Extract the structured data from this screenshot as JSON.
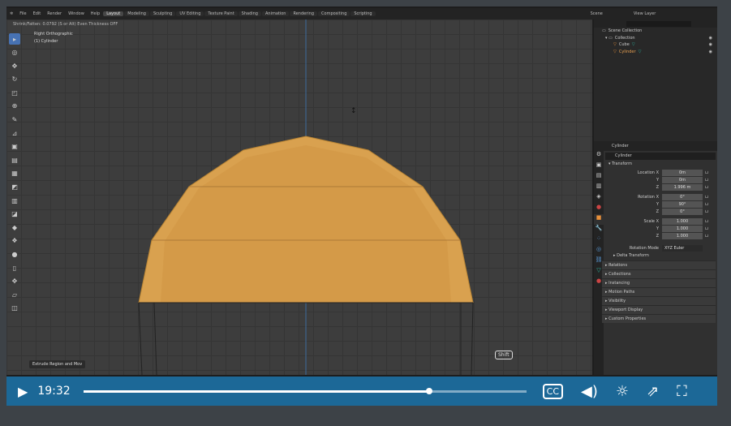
{
  "menu": [
    "File",
    "Edit",
    "Render",
    "Window",
    "Help"
  ],
  "workspaces": [
    "Layout",
    "Modeling",
    "Sculpting",
    "UV Editing",
    "Texture Paint",
    "Shading",
    "Animation",
    "Rendering",
    "Compositing",
    "Scripting"
  ],
  "scene": "Scene",
  "view_layer": "View Layer",
  "viewport": {
    "header_info": "Shrink/Fatten: 0.0792 (S or Alt) Even Thickness OFF",
    "view_name": "Right Orthographic",
    "object_name": "(1) Cylinder",
    "operator_panel": "Extrude Region and Mov",
    "key_overlay": "Shift"
  },
  "outliner": {
    "items": [
      "Scene Collection",
      "Collection",
      "Cube",
      "Cylinder"
    ]
  },
  "properties": {
    "object": "Cylinder",
    "object_field": "Cylinder",
    "section": "Transform",
    "fields": [
      {
        "label": "Location X",
        "value": "0m"
      },
      {
        "label": "Y",
        "value": "0m"
      },
      {
        "label": "Z",
        "value": "1.996 m"
      },
      {
        "label": "Rotation X",
        "value": "0°"
      },
      {
        "label": "Y",
        "value": "90°"
      },
      {
        "label": "Z",
        "value": "0°"
      },
      {
        "label": "Scale X",
        "value": "1.000"
      },
      {
        "label": "Y",
        "value": "1.000"
      },
      {
        "label": "Z",
        "value": "1.000"
      }
    ],
    "rotation_mode_label": "Rotation Mode",
    "rotation_mode": "XYZ Euler",
    "delta": "Delta Transform",
    "sections": [
      "Relations",
      "Collections",
      "Instancing",
      "Motion Paths",
      "Visibility",
      "Viewport Display",
      "Custom Properties"
    ]
  },
  "player": {
    "time": "19:32",
    "progress": 0.78,
    "accent": "#1c6ea0"
  }
}
